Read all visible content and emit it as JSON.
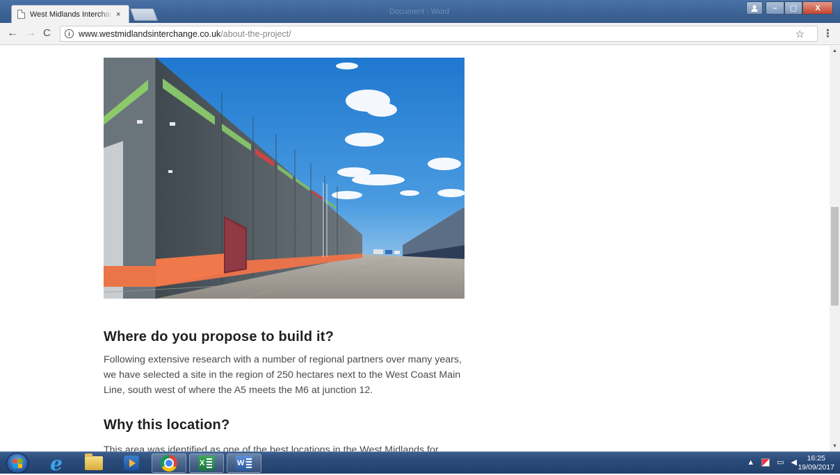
{
  "browser": {
    "tab_title": "West Midlands Interchange",
    "tab_close": "×",
    "window_title": "Document - Word",
    "url_host": "www.westmidlandsinterchange.co.uk",
    "url_path": "/about-the-project/",
    "icons": {
      "back": "←",
      "forward": "→",
      "reload": "C",
      "info": "i",
      "star": "☆",
      "menu": "⋮",
      "minimize": "–",
      "maximize": "▢",
      "close": "X"
    }
  },
  "page": {
    "sections": [
      {
        "heading": "Where do you propose to build it?",
        "body": "Following extensive research with a number of regional partners over many years, we have selected a site in the region of 250 hectares next to the West Coast Main Line, south west of where the A5 meets the M6 at junction 12."
      },
      {
        "heading": "Why this location?",
        "body": "This area was identified as one of the best locations in the West Midlands for"
      }
    ]
  },
  "taskbar": {
    "clock_time": "16:25",
    "clock_date": "19/09/2017",
    "excel_label": "X",
    "word_label": "W"
  },
  "colors": {
    "taskbar": "#2a4a78",
    "heading": "#1f1f1f",
    "body_text": "#4a4a4a",
    "sky": "#2f86d6"
  }
}
